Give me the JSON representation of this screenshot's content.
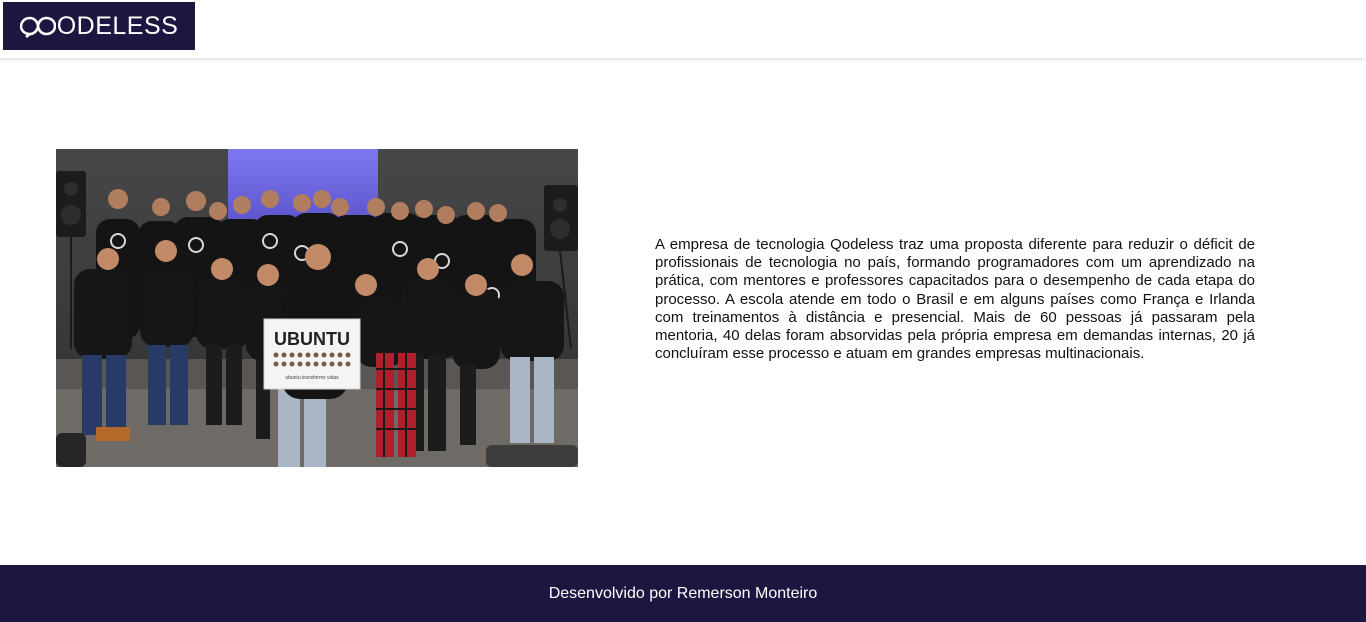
{
  "header": {
    "logo_text": "QODELESS",
    "logo_text_rest": "ODELESS",
    "brand_color": "#1b1740"
  },
  "main": {
    "photo": {
      "sign_text": "UBUNTU",
      "sign_subtext": "ubuntu transforms vidas"
    },
    "description": "A empresa de tecnologia Qodeless traz uma proposta diferente para reduzir o déficit de profissionais de tecnologia no país, formando programadores com um aprendizado na prática, com mentores e professores capacitados para o desempenho de cada etapa do processo. A escola atende em todo o Brasil e em alguns países como França e Irlanda com treinamentos à distância e presencial. Mais de 60 pessoas já passaram pela mentoria, 40 delas foram absorvidas pela própria empresa em demandas internas, 20 já concluíram esse processo e atuam em grandes empresas multinacionais."
  },
  "footer": {
    "credit": "Desenvolvido por Remerson Monteiro"
  }
}
